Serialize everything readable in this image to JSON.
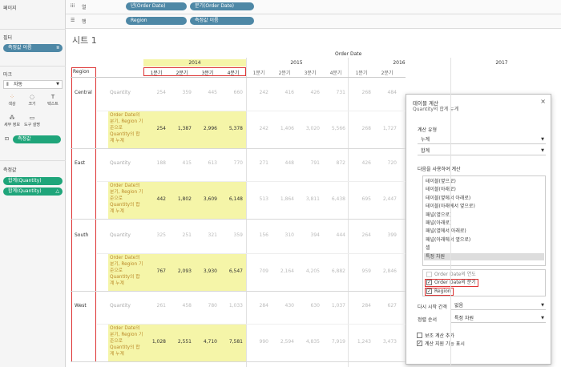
{
  "left": {
    "pages": "페이지",
    "filters": "필터",
    "filter_pill": "측정값 이름",
    "marks": "마크",
    "mark_type": "자동",
    "mark_buttons": [
      "색상",
      "크기",
      "텍스트",
      "세부 정보",
      "도구 설명"
    ],
    "measure_pill": "측정값",
    "measure_values": "측정값",
    "mv_pills": [
      "합계(Quantity)",
      "합계(Quantity)"
    ]
  },
  "shelves": {
    "columns_label": "열",
    "rows_label": "행",
    "col_pills": [
      "년(Order Date)",
      "분기(Order Date)"
    ],
    "row_pills": [
      "Region",
      "측정값 이름"
    ]
  },
  "sheet": {
    "title": "시트 1",
    "order_date": "Order Date",
    "region_header": "Region",
    "years": [
      "2014",
      "2015",
      "2016",
      "2017"
    ],
    "quarters": [
      "1분기",
      "2분기",
      "3분기",
      "4분기"
    ],
    "measure1": "Quantity",
    "measure2": "Order Date의 분기, Region 기준으로 Quantity의 합계 누계"
  },
  "regions": [
    {
      "name": "Central",
      "q": [
        "254",
        "359",
        "445",
        "660",
        "242",
        "416",
        "426",
        "731",
        "268",
        "484"
      ],
      "c": [
        "254",
        "1,387",
        "2,996",
        "5,378",
        "242",
        "1,406",
        "3,020",
        "5,566",
        "268",
        "1,727"
      ]
    },
    {
      "name": "East",
      "q": [
        "188",
        "415",
        "613",
        "770",
        "271",
        "448",
        "791",
        "872",
        "426",
        "720"
      ],
      "c": [
        "442",
        "1,802",
        "3,609",
        "6,148",
        "513",
        "1,864",
        "3,811",
        "6,438",
        "695",
        "2,447"
      ]
    },
    {
      "name": "South",
      "q": [
        "325",
        "251",
        "321",
        "359",
        "156",
        "310",
        "394",
        "444",
        "264",
        "399"
      ],
      "c": [
        "767",
        "2,093",
        "3,930",
        "6,547",
        "709",
        "2,164",
        "4,205",
        "6,882",
        "959",
        "2,846"
      ]
    },
    {
      "name": "West",
      "q": [
        "261",
        "458",
        "780",
        "1,033",
        "284",
        "430",
        "630",
        "1,037",
        "284",
        "627"
      ],
      "c": [
        "1,028",
        "2,551",
        "4,710",
        "7,581",
        "990",
        "2,594",
        "4,835",
        "7,919",
        "1,243",
        "3,473"
      ]
    }
  ],
  "dialog": {
    "title": "테이블 계산",
    "subtitle": "Quantity의 합계 누계",
    "calc_type_label": "계산 유형",
    "calc_type": "누계",
    "agg": "합계",
    "compute_using": "다음을 사용하여 계산",
    "options": [
      "테이블(옆으로)",
      "테이블(아래로)",
      "테이블(옆에서 아래로)",
      "테이블(아래에서 옆으로)",
      "패널(옆으로)",
      "패널(아래로)",
      "패널(옆에서 아래로)",
      "패널(아래에서 옆으로)",
      "셀",
      "특정 차원"
    ],
    "dims": [
      "Order Date의 연도",
      "Order Date의 분기",
      "Region"
    ],
    "restart_label": "다시 시작 간격",
    "restart_value": "없음",
    "sort_label": "정렬 순서",
    "sort_value": "특정 차원",
    "add_secondary": "보조 계산 추가",
    "show_hint": "계산 지원 기능 표시"
  }
}
